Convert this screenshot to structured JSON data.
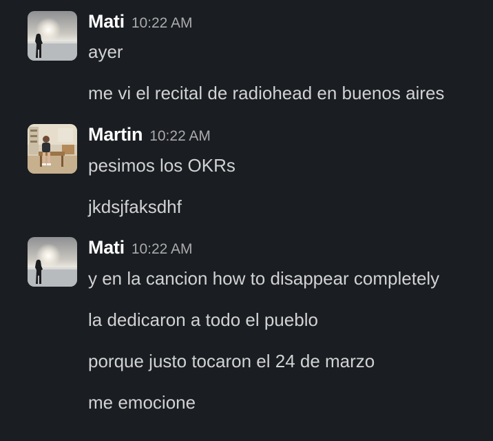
{
  "messages": [
    {
      "sender": "Mati",
      "time": "10:22 AM",
      "avatar": "sunset-figure-avatar",
      "lines": [
        "ayer",
        "me vi el recital de radiohead en buenos aires"
      ]
    },
    {
      "sender": "Martin",
      "time": "10:22 AM",
      "avatar": "room-seated-avatar",
      "lines": [
        "pesimos los OKRs",
        "jkdsjfaksdhf"
      ]
    },
    {
      "sender": "Mati",
      "time": "10:22 AM",
      "avatar": "sunset-figure-avatar",
      "lines": [
        "y en la cancion how to disappear completely",
        "la dedicaron a todo el pueblo",
        "porque justo tocaron el 24 de marzo",
        "me emocione"
      ]
    }
  ],
  "colors": {
    "background": "#1a1d21",
    "sender": "#ffffff",
    "timestamp": "#ababad",
    "text": "#d1d2d3"
  }
}
